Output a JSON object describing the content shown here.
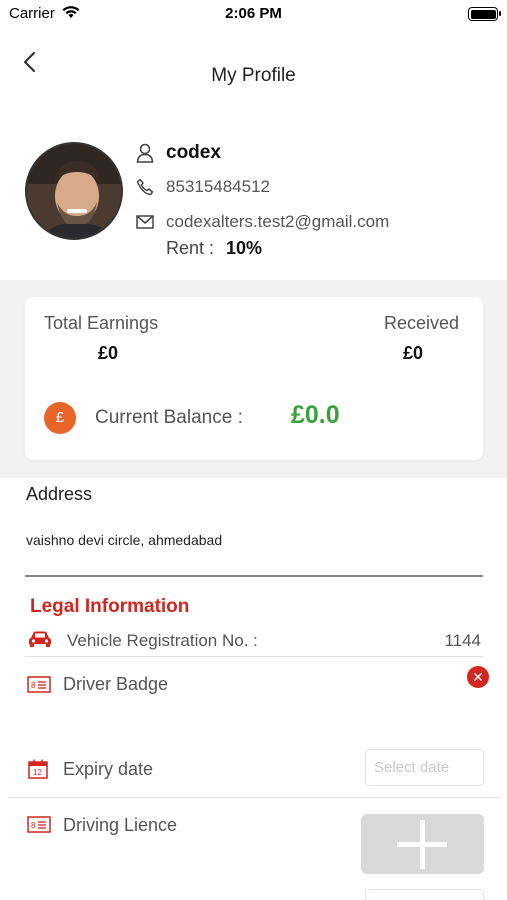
{
  "status_bar": {
    "carrier": "Carrier",
    "time": "2:06 PM"
  },
  "nav": {
    "title": "My Profile"
  },
  "profile": {
    "name": "codex",
    "phone": "85315484512",
    "email": "codexalters.test2@gmail.com",
    "rent_label": "Rent :",
    "rent_value": "10%"
  },
  "earnings": {
    "total_label": "Total Earnings",
    "total_value": "£0",
    "received_label": "Received",
    "received_value": "£0",
    "currency_symbol": "£",
    "balance_label": "Current Balance :",
    "balance_value": "£0.0"
  },
  "address": {
    "title": "Address",
    "value": "vaishno devi circle, ahmedabad"
  },
  "legal": {
    "title": "Legal Information",
    "vehicle_label": "Vehicle Registration No. :",
    "vehicle_value": "1144",
    "driver_badge_label": "Driver Badge",
    "expiry_label": "Expiry date",
    "expiry_placeholder": "Select date",
    "driving_licence_label": "Driving Lience"
  },
  "colors": {
    "accent_red": "#d3261e",
    "balance_green": "#37a33a",
    "coin_orange": "#e8652a"
  }
}
